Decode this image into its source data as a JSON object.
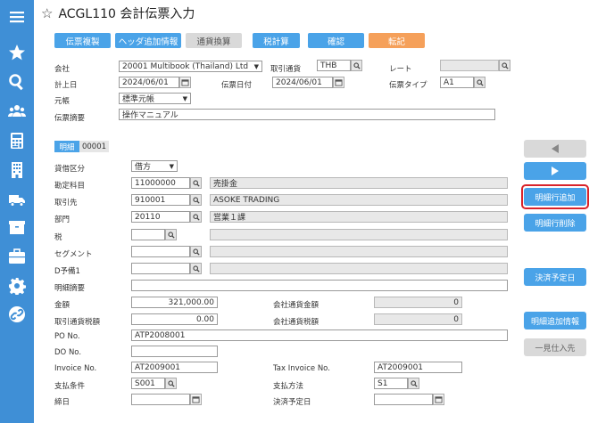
{
  "header": {
    "title": "ACGL110 会計伝票入力"
  },
  "colors": {
    "sidebar": "#3f8fd6",
    "primary_button": "#4aa3e8",
    "disabled_button": "#d9d9d9",
    "post_button": "#f5a05a",
    "highlight": "#d9232a"
  },
  "sidebar": {
    "icons": [
      "menu-icon",
      "star-icon",
      "search-icon",
      "users-icon",
      "calculator-icon",
      "building-icon",
      "truck-icon",
      "box-icon",
      "briefcase-icon",
      "gear-icon",
      "link-icon"
    ]
  },
  "toolbar": {
    "copy": "伝票複製",
    "add_header_info": "ヘッダ追加情報",
    "currency_convert": "通貨換算",
    "tax_calc": "税計算",
    "confirm": "確認",
    "post": "転記"
  },
  "header_form": {
    "company_label": "会社",
    "company_value": "20001 Multibook (Thailand) Ltd",
    "currency_label": "取引通貨",
    "currency_value": "THB",
    "rate_label": "レート",
    "rate_value": "",
    "posting_date_label": "計上日",
    "posting_date_value": "2024/06/01",
    "doc_date_label": "伝票日付",
    "doc_date_value": "2024/06/01",
    "doc_type_label": "伝票タイプ",
    "doc_type_value": "A1",
    "ledger_label": "元帳",
    "ledger_value": "標準元帳",
    "summary_label": "伝票摘要",
    "summary_value": "操作マニュアル"
  },
  "detail": {
    "tab_label": "明細",
    "tab_number": "00001",
    "dc_label": "貸借区分",
    "dc_value": "借方",
    "account_label": "勘定科目",
    "account_code": "11000000",
    "account_name": "売掛金",
    "partner_label": "取引先",
    "partner_code": "910001",
    "partner_name": "ASOKE TRADING",
    "dept_label": "部門",
    "dept_code": "20110",
    "dept_name": "営業１課",
    "tax_label": "税",
    "segment_label": "セグメント",
    "reserve_label": "D予備1",
    "line_summary_label": "明細摘要",
    "amount_label": "金額",
    "amount_value": "321,000.00",
    "company_amount_label": "会社通貨金額",
    "company_amount_value": "0",
    "tax_amount_label": "取引通貨税額",
    "tax_amount_value": "0.00",
    "company_tax_label": "会社通貨税額",
    "company_tax_value": "0",
    "po_label": "PO No.",
    "po_value": "ATP2008001",
    "do_label": "DO No.",
    "do_value": "",
    "invoice_label": "Invoice No.",
    "invoice_value": "AT2009001",
    "tax_invoice_label": "Tax Invoice No.",
    "tax_invoice_value": "AT2009001",
    "pay_terms_label": "支払条件",
    "pay_terms_value": "S001",
    "pay_method_label": "支払方法",
    "pay_method_value": "S1",
    "due_label": "締日",
    "settle_label": "決済予定日"
  },
  "right_panel": {
    "add_line": "明細行追加",
    "delete_line": "明細行削除",
    "settle_date": "決済予定日",
    "line_extra": "明細追加情報",
    "one_time_vendor": "一見仕入先"
  }
}
